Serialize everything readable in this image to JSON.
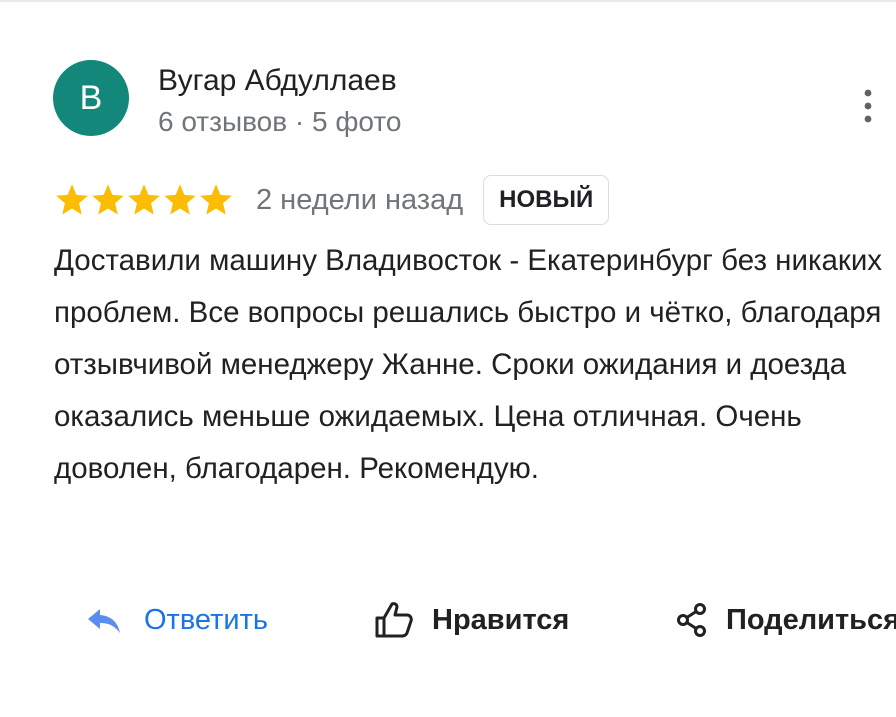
{
  "review": {
    "author": {
      "initial": "B",
      "name": "Вугар Абдуллаев",
      "meta": "6 отзывов · 5 фото",
      "avatar_color": "#12877a"
    },
    "rating": {
      "stars": 5,
      "max": 5,
      "star_color": "#fbbc04",
      "icon": "star-icon"
    },
    "age": "2 недели назад",
    "badge": "НОВЫЙ",
    "text": "Доставили машину Владивосток - Екатеринбург без никаких проблем. Все вопросы решались быстро и чётко, благодаря отзывчивой менеджеру Жанне. Сроки ожидания и доезда оказались меньше ожидаемых. Цена отличная. Очень доволен, благодарен. Рекомендую."
  },
  "menu": {
    "icon": "more-vert-icon"
  },
  "actions": {
    "reply_label": "Ответить",
    "reply_icon": "reply-icon",
    "like_label": "Нравится",
    "like_icon": "thumb-up-icon",
    "share_label": "Поделиться",
    "share_icon": "share-icon"
  },
  "colors": {
    "accent": "#1a73e8",
    "text_primary": "#202124",
    "text_secondary": "#70757a",
    "divider": "#dadce0"
  }
}
